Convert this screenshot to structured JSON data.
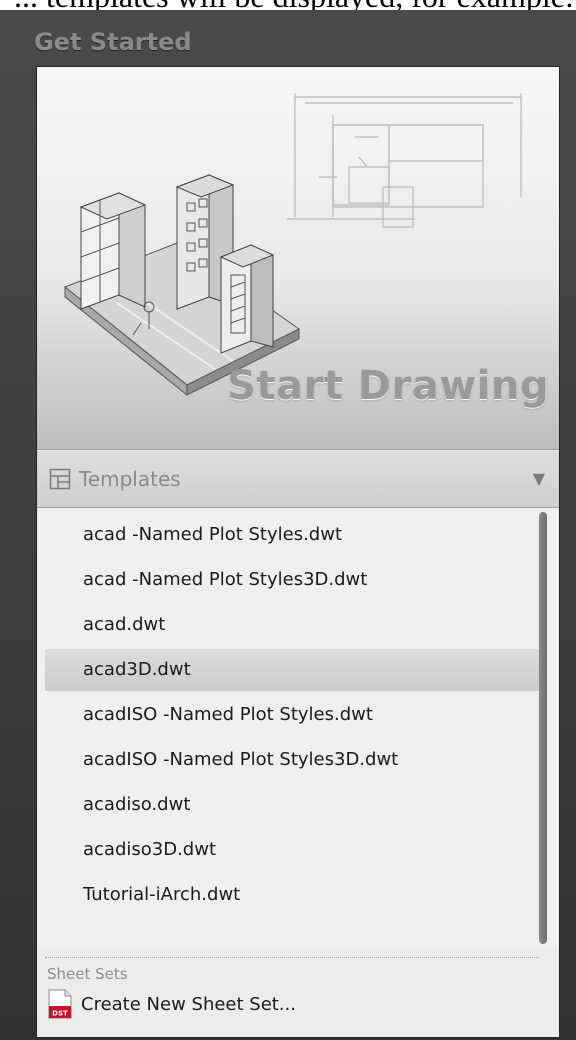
{
  "top_caption": "... templates will be displayed, for example:",
  "header": {
    "title": "Get Started"
  },
  "hero": {
    "label": "Start Drawing"
  },
  "templates": {
    "label": "Templates",
    "dropdown_icon": "triangle-down-icon",
    "items": [
      {
        "label": "acad -Named Plot Styles.dwt",
        "selected": false
      },
      {
        "label": "acad -Named Plot Styles3D.dwt",
        "selected": false
      },
      {
        "label": "acad.dwt",
        "selected": false
      },
      {
        "label": "acad3D.dwt",
        "selected": true
      },
      {
        "label": "acadISO -Named Plot Styles.dwt",
        "selected": false
      },
      {
        "label": "acadISO -Named Plot Styles3D.dwt",
        "selected": false
      },
      {
        "label": "acadiso.dwt",
        "selected": false
      },
      {
        "label": "acadiso3D.dwt",
        "selected": false
      },
      {
        "label": "Tutorial-iArch.dwt",
        "selected": false
      }
    ]
  },
  "sheet_sets": {
    "heading": "Sheet Sets",
    "create_label": "Create New Sheet Set...",
    "icon_text": "DST"
  },
  "colors": {
    "background": "#3d3d3d",
    "panel": "#ececec",
    "selected_row": "#d2d2d2",
    "muted_text": "#8a8a8a",
    "dst_red": "#c8102e"
  }
}
